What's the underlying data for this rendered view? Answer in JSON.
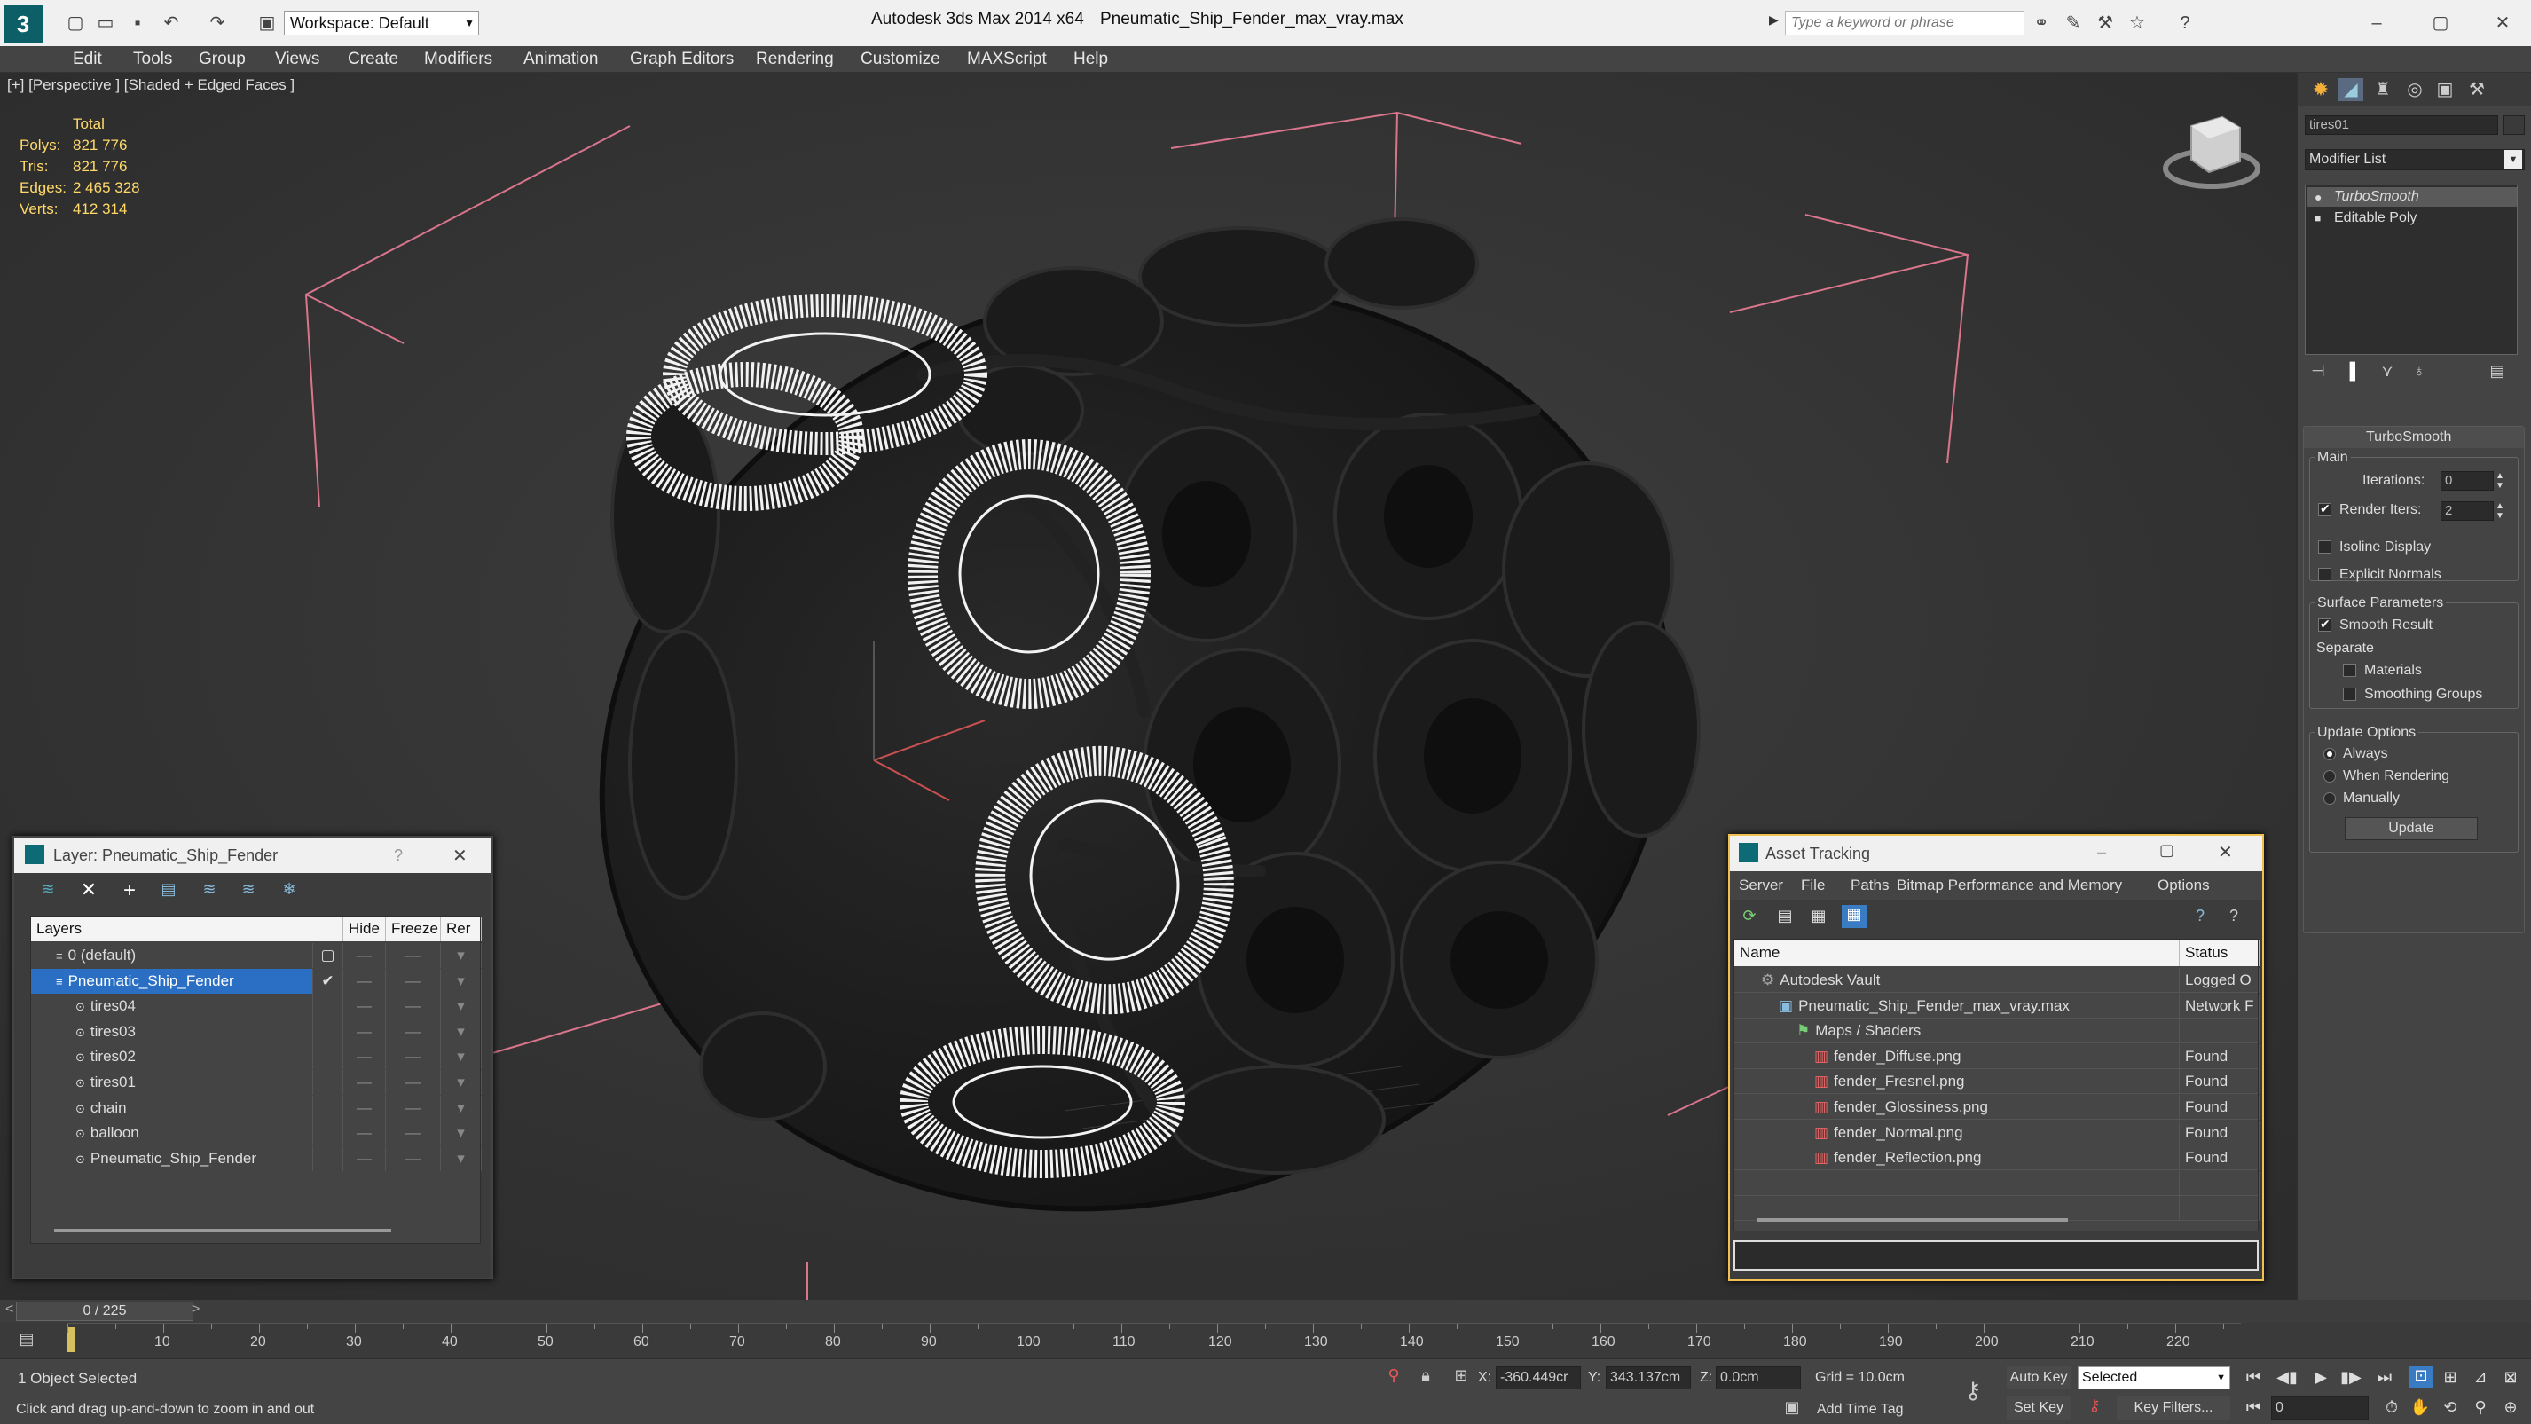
{
  "titlebar": {
    "app_title": "Autodesk 3ds Max  2014 x64",
    "file_title": "Pneumatic_Ship_Fender_max_vray.max",
    "workspace_label": "Workspace: Default",
    "search_placeholder": "Type a keyword or phrase"
  },
  "menu": [
    "Edit",
    "Tools",
    "Group",
    "Views",
    "Create",
    "Modifiers",
    "Animation",
    "Graph Editors",
    "Rendering",
    "Customize",
    "MAXScript",
    "Help"
  ],
  "viewport": {
    "label": "[+] [Perspective ] [Shaded + Edged Faces ]",
    "stats": {
      "header": "Total",
      "polys_label": "Polys:",
      "polys": "821 776",
      "tris_label": "Tris:",
      "tris": "821 776",
      "edges_label": "Edges:",
      "edges": "2 465 328",
      "verts_label": "Verts:",
      "verts": "412 314"
    }
  },
  "command_panel": {
    "object_name": "tires01",
    "modifier_list": "Modifier List",
    "stack": [
      "TurboSmooth",
      "Editable Poly"
    ],
    "rollout_title": "TurboSmooth",
    "main_group": "Main",
    "iterations_label": "Iterations:",
    "iterations_value": "0",
    "render_iters_label": "Render Iters:",
    "render_iters_value": "2",
    "isoline_label": "Isoline Display",
    "explicit_normals_label": "Explicit Normals",
    "surface_group": "Surface Parameters",
    "smooth_result_label": "Smooth Result",
    "separate_label": "Separate",
    "materials_label": "Materials",
    "smoothing_groups_label": "Smoothing Groups",
    "update_group": "Update Options",
    "always_label": "Always",
    "when_rendering_label": "When Rendering",
    "manually_label": "Manually",
    "update_button": "Update"
  },
  "layer_window": {
    "title": "Layer: Pneumatic_Ship_Fender",
    "help_glyph": "?",
    "columns": [
      "Layers",
      "Hide",
      "Freeze",
      "Rer"
    ],
    "rows": [
      {
        "name": "0 (default)",
        "indent": 1
      },
      {
        "name": "Pneumatic_Ship_Fender",
        "indent": 1,
        "selected": true
      },
      {
        "name": "tires04",
        "indent": 2
      },
      {
        "name": "tires03",
        "indent": 2
      },
      {
        "name": "tires02",
        "indent": 2
      },
      {
        "name": "tires01",
        "indent": 2
      },
      {
        "name": "chain",
        "indent": 2
      },
      {
        "name": "balloon",
        "indent": 2
      },
      {
        "name": "Pneumatic_Ship_Fender",
        "indent": 2
      }
    ]
  },
  "asset_window": {
    "title": "Asset Tracking",
    "menu": [
      "Server",
      "File",
      "Paths",
      "Bitmap Performance and Memory",
      "Options"
    ],
    "columns": [
      "Name",
      "Status"
    ],
    "rows": [
      {
        "name": "Autodesk Vault",
        "status": "Logged O",
        "indent": 1
      },
      {
        "name": "Pneumatic_Ship_Fender_max_vray.max",
        "status": "Network F",
        "indent": 2
      },
      {
        "name": "Maps / Shaders",
        "status": "",
        "indent": 3
      },
      {
        "name": "fender_Diffuse.png",
        "status": "Found",
        "indent": 4
      },
      {
        "name": "fender_Fresnel.png",
        "status": "Found",
        "indent": 4
      },
      {
        "name": "fender_Glossiness.png",
        "status": "Found",
        "indent": 4
      },
      {
        "name": "fender_Normal.png",
        "status": "Found",
        "indent": 4
      },
      {
        "name": "fender_Reflection.png",
        "status": "Found",
        "indent": 4
      }
    ]
  },
  "timeline": {
    "frame_label": "0 / 225",
    "ticks": [
      "10",
      "20",
      "30",
      "40",
      "50",
      "60",
      "70",
      "80",
      "90",
      "100",
      "110",
      "120",
      "130",
      "140",
      "150",
      "160",
      "170",
      "180",
      "190",
      "200",
      "210",
      "220"
    ]
  },
  "status": {
    "selection": "1 Object Selected",
    "prompt": "Click and drag up-and-down to zoom in and out",
    "x_label": "X:",
    "x_value": "-360.449cr",
    "y_label": "Y:",
    "y_value": "343.137cm",
    "z_label": "Z:",
    "z_value": "0.0cm",
    "grid": "Grid = 10.0cm",
    "add_time_tag": "Add Time Tag",
    "auto_key": "Auto Key",
    "set_key": "Set Key",
    "selected_dropdown": "Selected",
    "key_filters": "Key Filters...",
    "frame_value": "0"
  }
}
